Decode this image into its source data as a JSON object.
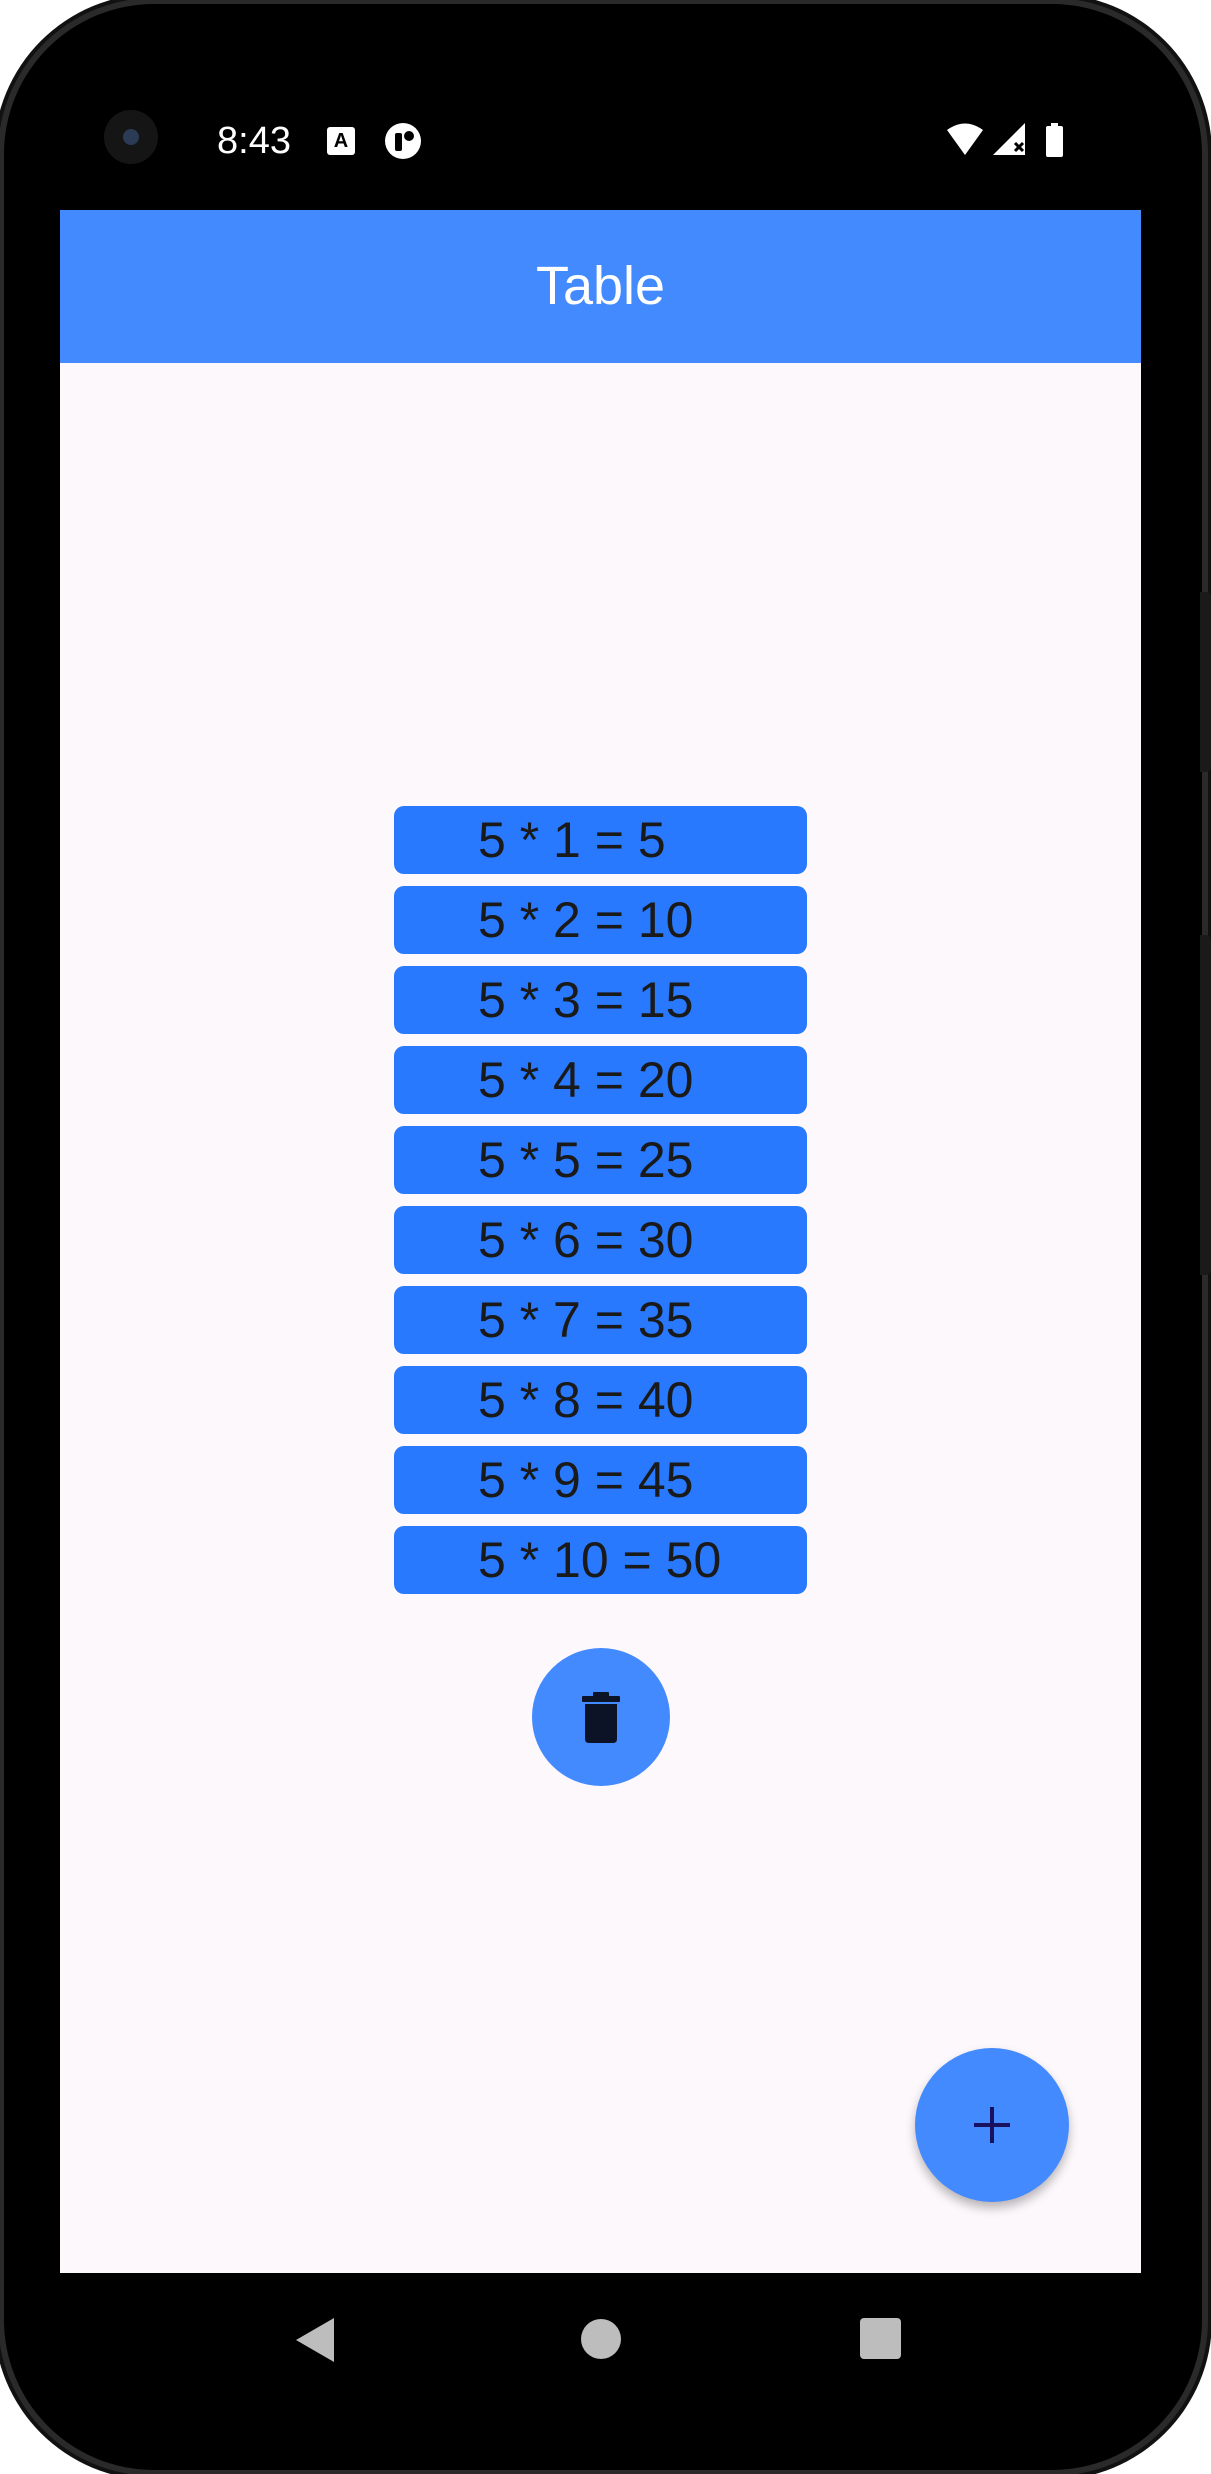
{
  "status_bar": {
    "time": "8:43",
    "notification_icons": [
      "a-text-icon",
      "tasker-icon"
    ],
    "system_icons": [
      "wifi-icon",
      "signal-no-data-icon",
      "battery-icon"
    ]
  },
  "app_bar": {
    "title": "Table"
  },
  "table": {
    "rows": [
      "5 * 1 = 5",
      "5 * 2 = 10",
      "5 * 3 = 15",
      "5 * 4 = 20",
      "5 * 5 = 25",
      "5 * 6 = 30",
      "5 * 7 = 35",
      "5 * 8 = 40",
      "5 * 9 = 45",
      "5 * 10 = 50"
    ]
  },
  "actions": {
    "delete_icon": "trash-icon",
    "add_icon": "plus-icon"
  },
  "navigation": {
    "icons": [
      "back-icon",
      "home-icon",
      "recents-icon"
    ]
  },
  "colors": {
    "primary": "#448aff",
    "row_background": "#2979ff",
    "screen_background": "#fdf8fc",
    "app_bar_text": "#ffffff",
    "row_text": "#1a1a1a",
    "fab_icon": "#1a1060"
  }
}
